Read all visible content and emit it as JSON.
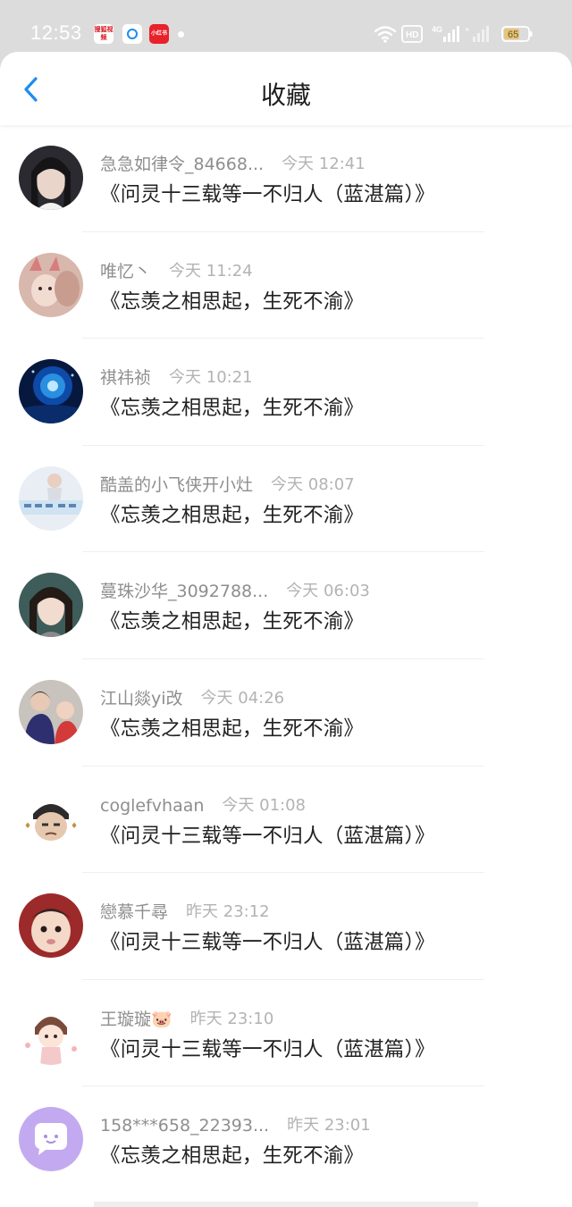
{
  "status_bar": {
    "time": "12:53",
    "app_icons": [
      {
        "name": "sohu-video-icon",
        "text": "搜狐视频"
      },
      {
        "name": "blue-app-icon",
        "text": ""
      },
      {
        "name": "xiaohongshu-icon",
        "text": "小红书"
      }
    ],
    "network_label": "HD",
    "signal_label": "4G",
    "battery": "65"
  },
  "header": {
    "title": "收藏",
    "back_icon": "chevron-left-icon",
    "accent_color": "#1e8cf0"
  },
  "items": [
    {
      "username": "急急如律令_84668...",
      "time": "今天 12:41",
      "title": "《问灵十三载等一不归人（蓝湛篇）》"
    },
    {
      "username": "唯忆丶",
      "time": "今天 11:24",
      "title": "《忘羡之相思起，生死不渝》"
    },
    {
      "username": "祺祎祯",
      "time": "今天 10:21",
      "title": "《忘羡之相思起，生死不渝》"
    },
    {
      "username": "酷盖的小飞侠开小灶",
      "time": "今天 08:07",
      "title": "《忘羡之相思起，生死不渝》"
    },
    {
      "username": "蔓珠沙华_3092788...",
      "time": "今天 06:03",
      "title": "《忘羡之相思起，生死不渝》"
    },
    {
      "username": "江山燚yi改",
      "time": "今天 04:26",
      "title": "《忘羡之相思起，生死不渝》"
    },
    {
      "username": "coglefvhaan",
      "time": "今天 01:08",
      "title": "《问灵十三载等一不归人（蓝湛篇）》"
    },
    {
      "username": "戀慕千尋",
      "time": "昨天 23:12",
      "title": "《问灵十三载等一不归人（蓝湛篇）》"
    },
    {
      "username": "王璇璇🐷",
      "time": "昨天 23:10",
      "title": "《问灵十三载等一不归人（蓝湛篇）》"
    },
    {
      "username": "158***658_22393...",
      "time": "昨天 23:01",
      "title": "《忘羡之相思起，生死不渝》"
    }
  ]
}
